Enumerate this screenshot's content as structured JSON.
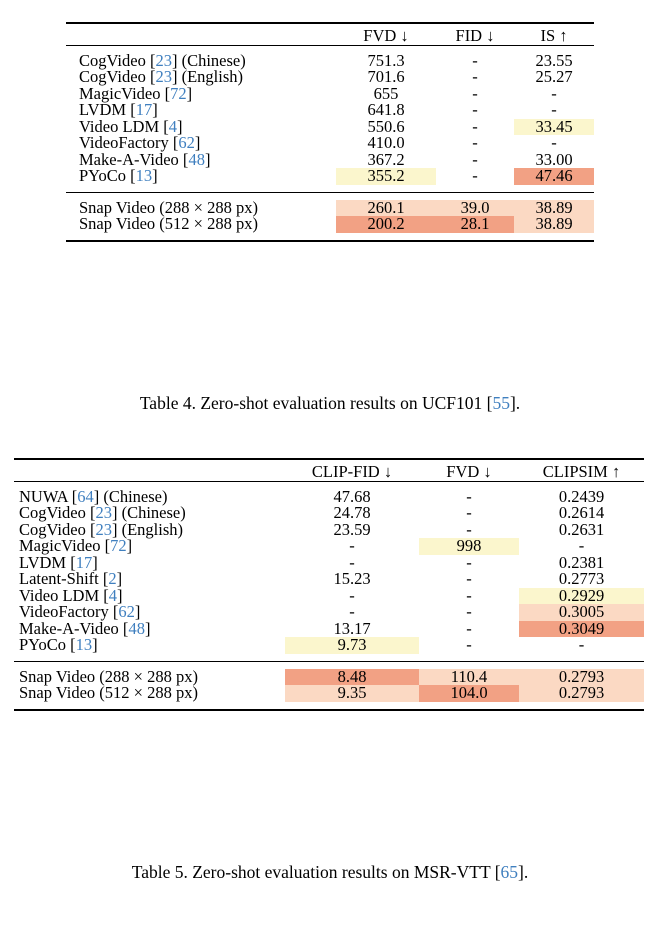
{
  "page": {
    "background": "#ffffff",
    "cite_color": "#3f7fbf",
    "highlight_yellow": "#fbf6cd",
    "highlight_light": "#fbd9c3",
    "highlight_dark": "#f2a184"
  },
  "table4": {
    "columns": [
      "",
      "FVD ↓",
      "FID ↓",
      "IS ↑"
    ],
    "rows": [
      {
        "name_pre": "CogVideo [",
        "cite": "23",
        "name_post": "] (Chinese)",
        "values": [
          "751.3",
          "-",
          "23.55"
        ],
        "hl": [
          "",
          "",
          ""
        ]
      },
      {
        "name_pre": "CogVideo [",
        "cite": "23",
        "name_post": "] (English)",
        "values": [
          "701.6",
          "-",
          "25.27"
        ],
        "hl": [
          "",
          "",
          ""
        ]
      },
      {
        "name_pre": "MagicVideo [",
        "cite": "72",
        "name_post": "]",
        "values": [
          "655",
          "-",
          "-"
        ],
        "hl": [
          "",
          "",
          ""
        ]
      },
      {
        "name_pre": "LVDM [",
        "cite": "17",
        "name_post": "]",
        "values": [
          "641.8",
          "-",
          "-"
        ],
        "hl": [
          "",
          "",
          ""
        ]
      },
      {
        "name_pre": "Video LDM [",
        "cite": "4",
        "name_post": "]",
        "values": [
          "550.6",
          "-",
          "33.45"
        ],
        "hl": [
          "",
          "",
          "hl-yellow"
        ]
      },
      {
        "name_pre": "VideoFactory [",
        "cite": "62",
        "name_post": "]",
        "values": [
          "410.0",
          "-",
          "-"
        ],
        "hl": [
          "",
          "",
          ""
        ]
      },
      {
        "name_pre": "Make-A-Video [",
        "cite": "48",
        "name_post": "]",
        "values": [
          "367.2",
          "-",
          "33.00"
        ],
        "hl": [
          "",
          "",
          ""
        ]
      },
      {
        "name_pre": "PYoCo [",
        "cite": "13",
        "name_post": "]",
        "values": [
          "355.2",
          "-",
          "47.46"
        ],
        "hl": [
          "hl-yellow",
          "",
          "hl-dark"
        ]
      }
    ],
    "ours": [
      {
        "name_pre": "Snap Video (288 × 288 px)",
        "cite": "",
        "name_post": "",
        "values": [
          "260.1",
          "39.0",
          "38.89"
        ],
        "hl": [
          "hl-light",
          "hl-light",
          "hl-light"
        ]
      },
      {
        "name_pre": "Snap Video (512 × 288 px)",
        "cite": "",
        "name_post": "",
        "values": [
          "200.2",
          "28.1",
          "38.89"
        ],
        "hl": [
          "hl-dark",
          "hl-dark",
          "hl-light"
        ]
      }
    ],
    "caption_pre": "Table 4. Zero-shot evaluation results on UCF101 [",
    "caption_cite": "55",
    "caption_post": "]."
  },
  "table5": {
    "columns": [
      "",
      "CLIP-FID ↓",
      "FVD ↓",
      "CLIPSIM ↑"
    ],
    "rows": [
      {
        "name_pre": "NUWA [",
        "cite": "64",
        "name_post": "] (Chinese)",
        "values": [
          "47.68",
          "-",
          "0.2439"
        ],
        "hl": [
          "",
          "",
          ""
        ]
      },
      {
        "name_pre": "CogVideo [",
        "cite": "23",
        "name_post": "] (Chinese)",
        "values": [
          "24.78",
          "-",
          "0.2614"
        ],
        "hl": [
          "",
          "",
          ""
        ]
      },
      {
        "name_pre": "CogVideo [",
        "cite": "23",
        "name_post": "] (English)",
        "values": [
          "23.59",
          "-",
          "0.2631"
        ],
        "hl": [
          "",
          "",
          ""
        ]
      },
      {
        "name_pre": "MagicVideo [",
        "cite": "72",
        "name_post": "]",
        "values": [
          "-",
          "998",
          "-"
        ],
        "hl": [
          "",
          "hl-yellow",
          ""
        ]
      },
      {
        "name_pre": "LVDM [",
        "cite": "17",
        "name_post": "]",
        "values": [
          "-",
          "-",
          "0.2381"
        ],
        "hl": [
          "",
          "",
          ""
        ]
      },
      {
        "name_pre": "Latent-Shift [",
        "cite": "2",
        "name_post": "]",
        "values": [
          "15.23",
          "-",
          "0.2773"
        ],
        "hl": [
          "",
          "",
          ""
        ]
      },
      {
        "name_pre": "Video LDM [",
        "cite": "4",
        "name_post": "]",
        "values": [
          "-",
          "-",
          "0.2929"
        ],
        "hl": [
          "",
          "",
          "hl-yellow"
        ]
      },
      {
        "name_pre": "VideoFactory [",
        "cite": "62",
        "name_post": "]",
        "values": [
          "-",
          "-",
          "0.3005"
        ],
        "hl": [
          "",
          "",
          "hl-light"
        ]
      },
      {
        "name_pre": "Make-A-Video [",
        "cite": "48",
        "name_post": "]",
        "values": [
          "13.17",
          "-",
          "0.3049"
        ],
        "hl": [
          "",
          "",
          "hl-dark"
        ]
      },
      {
        "name_pre": "PYoCo [",
        "cite": "13",
        "name_post": "]",
        "values": [
          "9.73",
          "-",
          "-"
        ],
        "hl": [
          "hl-yellow",
          "",
          ""
        ]
      }
    ],
    "ours": [
      {
        "name_pre": "Snap Video (288 × 288 px)",
        "cite": "",
        "name_post": "",
        "values": [
          "8.48",
          "110.4",
          "0.2793"
        ],
        "hl": [
          "hl-dark",
          "hl-light",
          "hl-light"
        ]
      },
      {
        "name_pre": "Snap Video (512 × 288 px)",
        "cite": "",
        "name_post": "",
        "values": [
          "9.35",
          "104.0",
          "0.2793"
        ],
        "hl": [
          "hl-light",
          "hl-dark",
          "hl-light"
        ]
      }
    ],
    "caption_pre": "Table 5. Zero-shot evaluation results on MSR-VTT [",
    "caption_cite": "65",
    "caption_post": "]."
  }
}
